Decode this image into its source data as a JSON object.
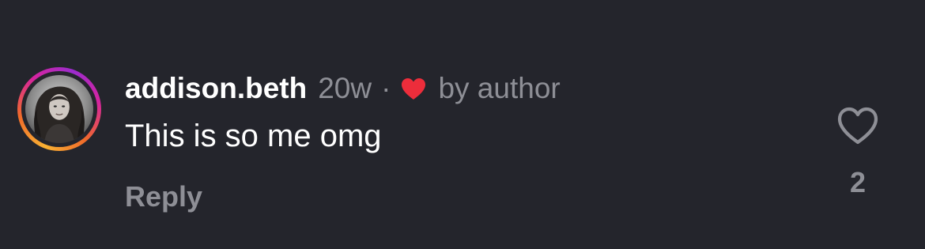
{
  "comment": {
    "username": "addison.beth",
    "timestamp": "20w",
    "separator": "·",
    "liked_by_label": "by author",
    "text": "This is so me omg",
    "reply_label": "Reply",
    "like_count": "2",
    "avatar_icon": "profile-photo",
    "liked_heart_icon": "heart-filled-icon",
    "like_icon": "heart-outline-icon"
  },
  "colors": {
    "background": "#24252c",
    "username": "#ffffff",
    "muted_text": "#8e8f96",
    "heart_red": "#ed2d3b",
    "story_ring": [
      "#f9b233",
      "#f06a2a",
      "#d6249f",
      "#9b2ccf"
    ]
  }
}
